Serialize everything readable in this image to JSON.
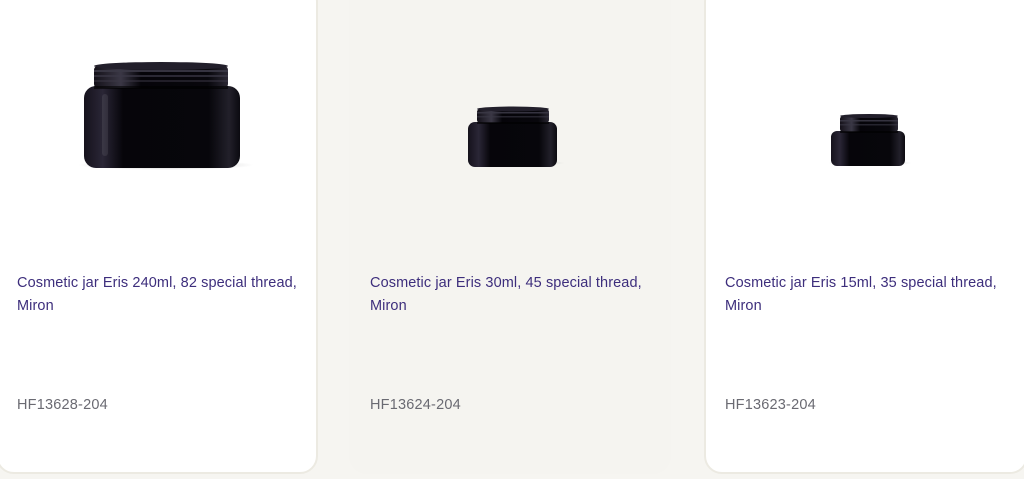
{
  "products": [
    {
      "title": "Cosmetic jar Eris 240ml, 82 special thread, Miron",
      "sku": "HF13628-204",
      "image_icon": "black-glass-jar-large"
    },
    {
      "title": "Cosmetic jar Eris 30ml, 45 special thread, Miron",
      "sku": "HF13624-204",
      "image_icon": "black-glass-jar-medium"
    },
    {
      "title": "Cosmetic jar Eris 15ml, 35 special thread, Miron",
      "sku": "HF13623-204",
      "image_icon": "black-glass-jar-small"
    }
  ],
  "colors": {
    "title": "#3d2e7c",
    "sku": "#6a6a72",
    "card_white": "#ffffff",
    "card_highlight": "#f5f4f0",
    "background": "#f6f5f1",
    "jar": "#0a0810"
  }
}
